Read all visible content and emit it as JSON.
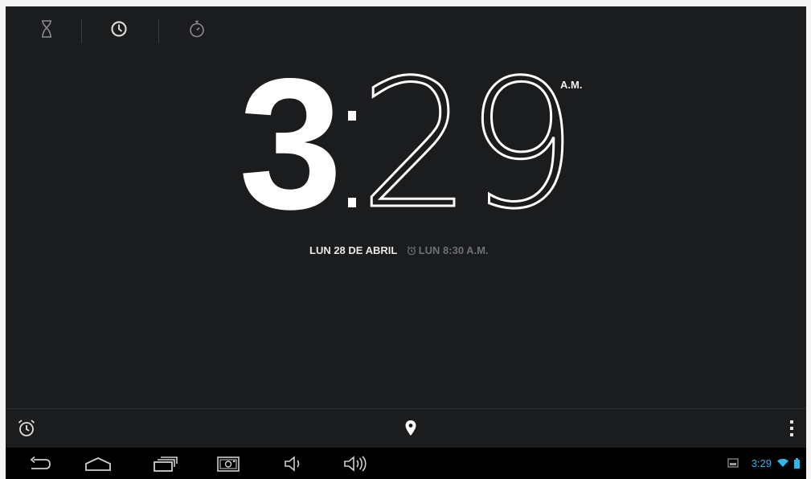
{
  "tabs": [
    {
      "icon": "hourglass-icon",
      "name": "timer"
    },
    {
      "icon": "clock-icon",
      "name": "clock"
    },
    {
      "icon": "stopwatch-icon",
      "name": "stopwatch"
    }
  ],
  "clock": {
    "hour": "3",
    "minutes": "29",
    "ampm": "A.M.",
    "date": "LUN 28 DE ABRIL",
    "next_alarm": "LUN 8:30 A.M."
  },
  "action_bar": {
    "left_icon": "alarm-clock-icon",
    "center_icon": "location-pin-icon",
    "right_icon": "overflow-menu-icon"
  },
  "nav_bar": {
    "buttons": [
      "back-icon",
      "home-icon",
      "recents-icon",
      "screenshot-icon",
      "volume-down-icon",
      "volume-up-icon"
    ]
  },
  "status": {
    "time": "3:29",
    "accent": "#33b5e5"
  }
}
